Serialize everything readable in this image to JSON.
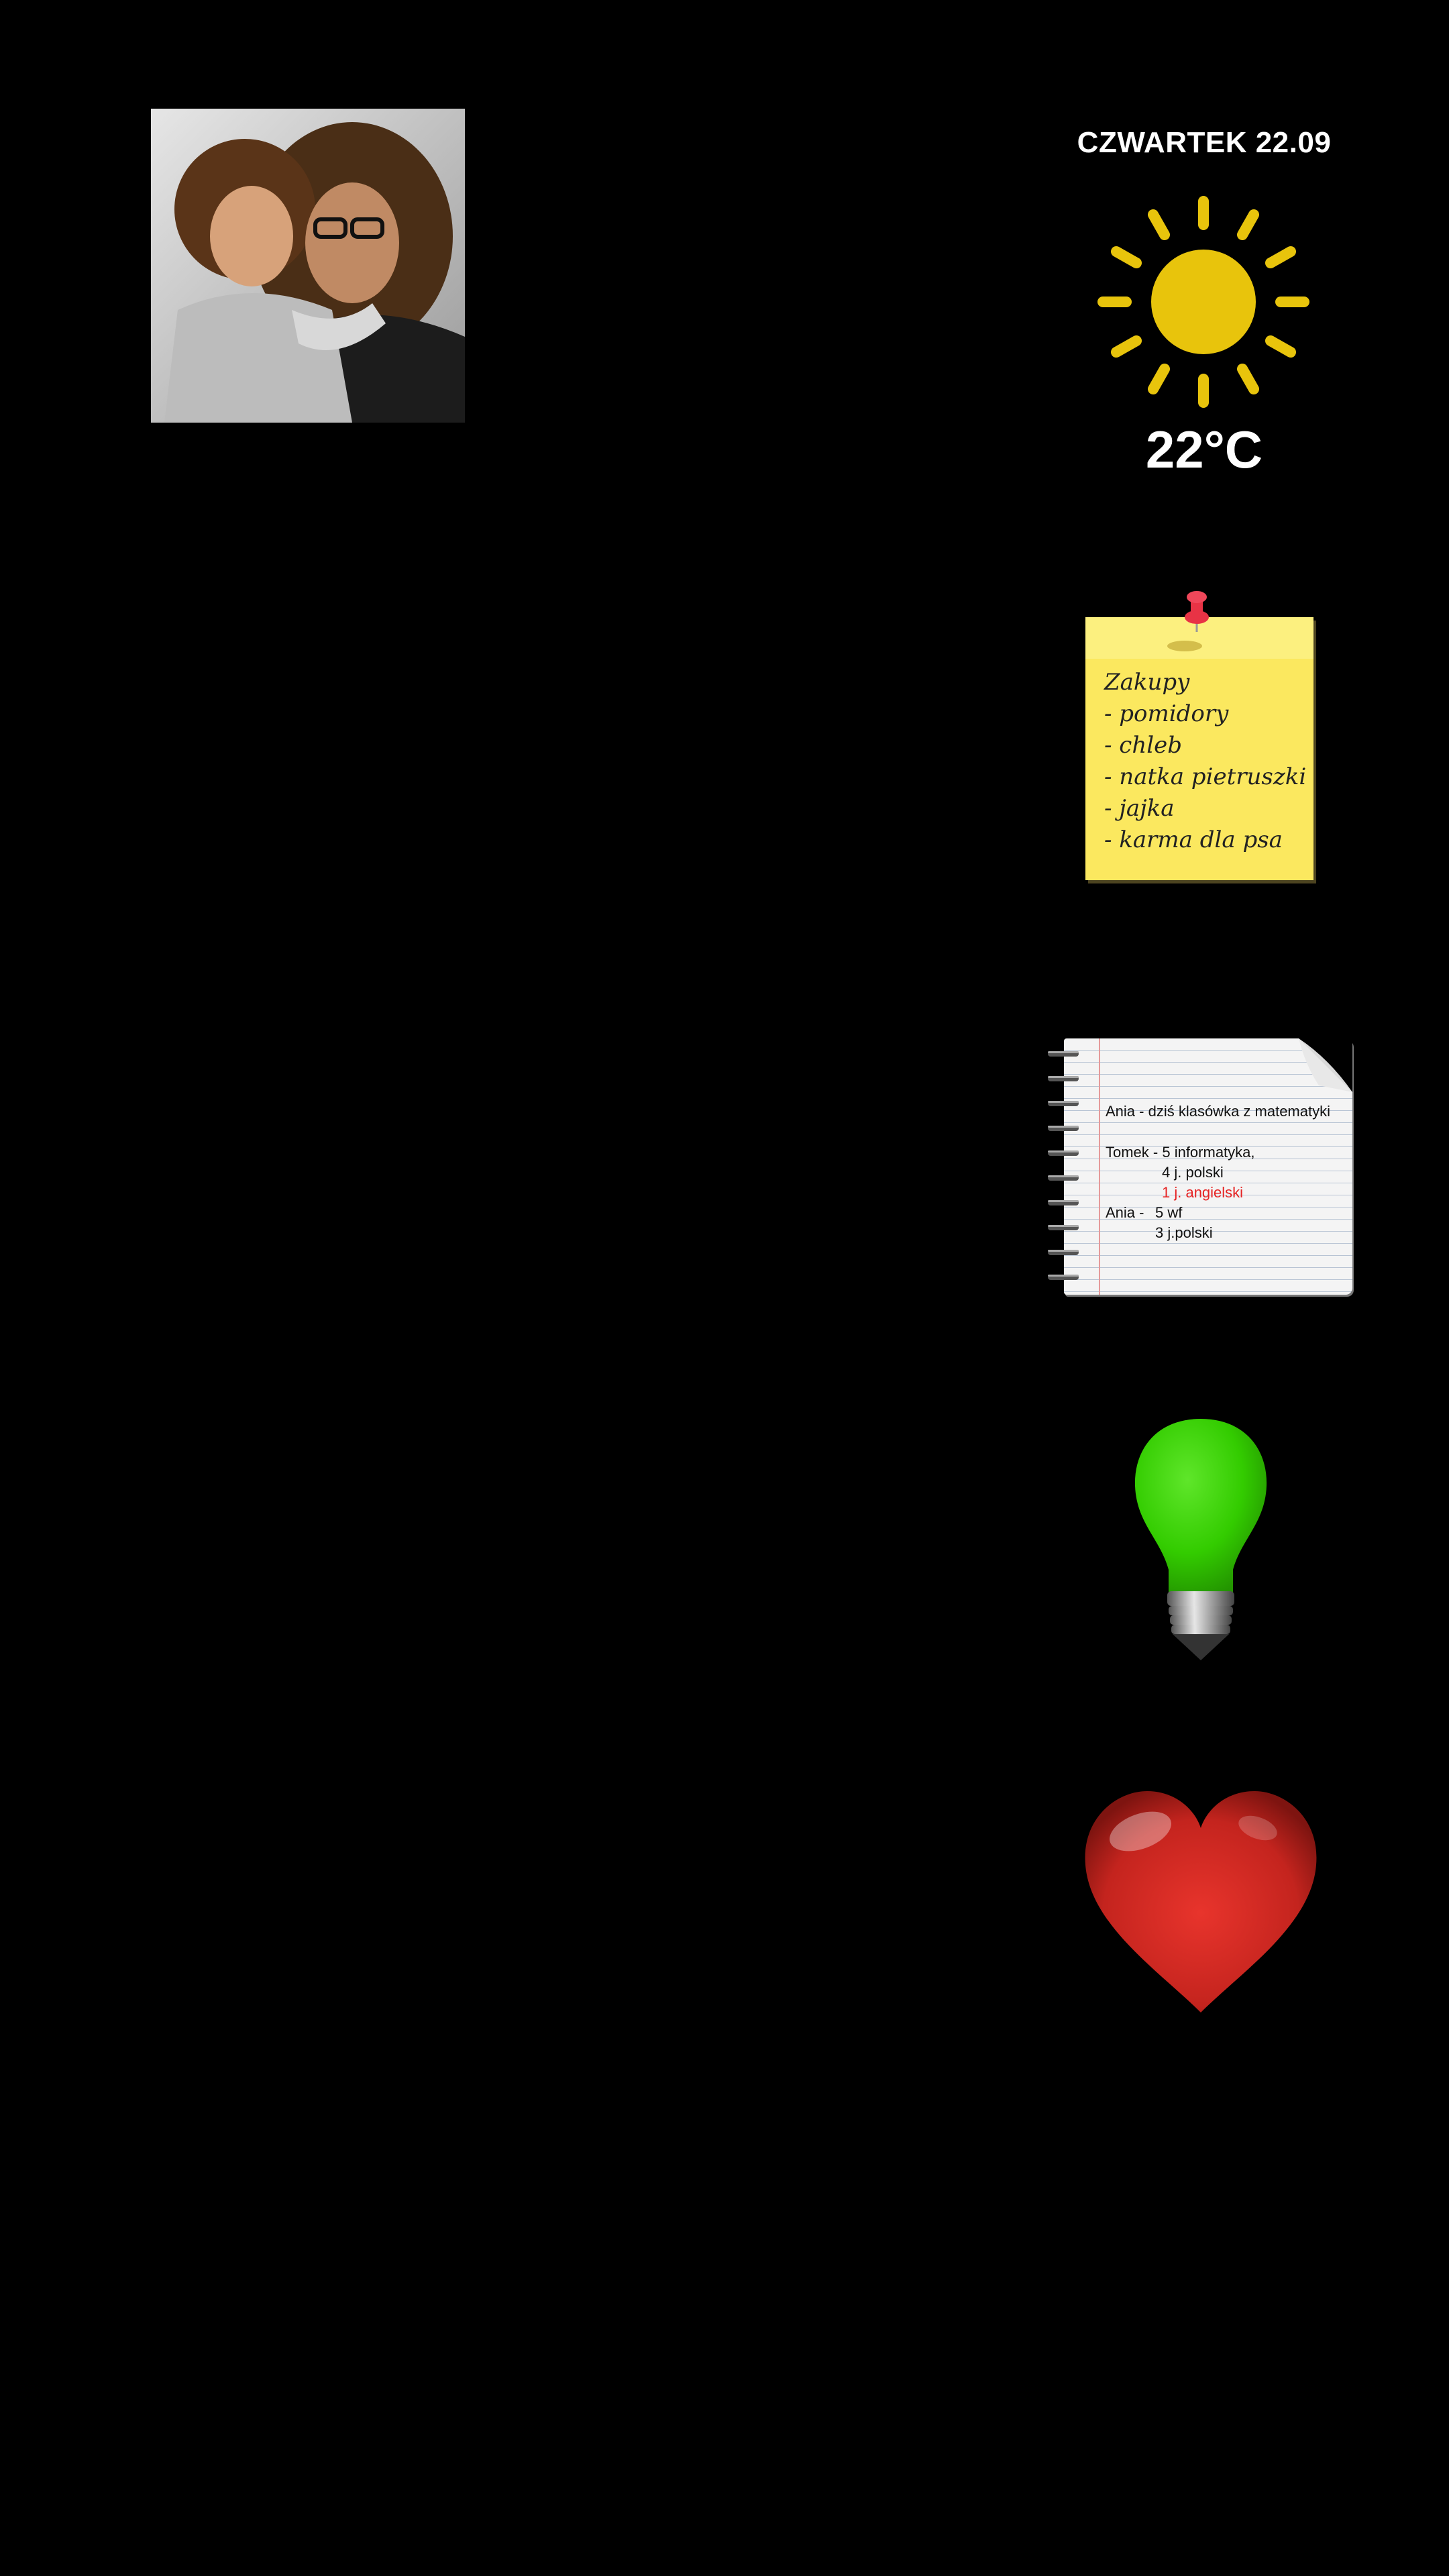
{
  "weather": {
    "date": "CZWARTEK 22.09",
    "temperature": "22°C",
    "icon": "sun-icon",
    "color": "#e8c40c"
  },
  "photo": {
    "icon": "family-photo"
  },
  "sticky_note": {
    "lines": [
      "Zakupy",
      "- pomidory",
      "- chleb",
      "- natka pietruszki",
      "- jajka",
      "- karma dla psa"
    ],
    "color": "#fbe85f"
  },
  "notebook": {
    "line1": "Ania - dziś klasówka z matematyki",
    "tomek_label": "Tomek - 5 informatyka,",
    "tomek_grade2": "4 j. polski",
    "tomek_grade3": "1 j. angielski",
    "ania_label": "Ania -",
    "ania_grade1": "5 wf",
    "ania_grade2": "3 j.polski",
    "highlight_color": "#e62222"
  },
  "bulb": {
    "icon": "lightbulb-icon",
    "color": "#33cc00"
  },
  "heart": {
    "icon": "heart-icon",
    "color": "#cc2222"
  }
}
